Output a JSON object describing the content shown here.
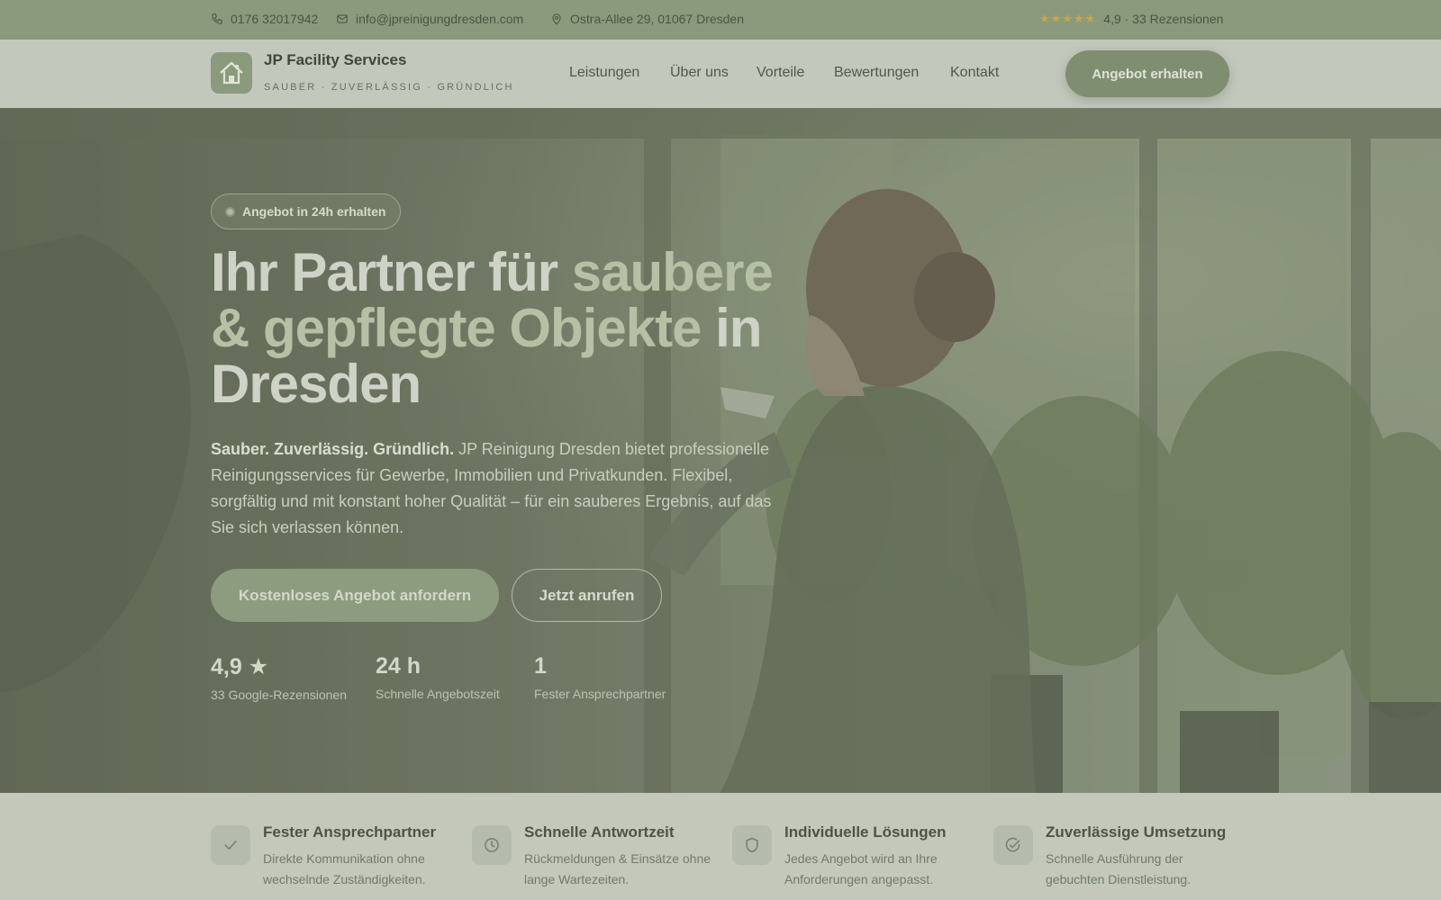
{
  "topbar": {
    "phone": "0176 32017942",
    "email": "info@jpreinigungdresden.com",
    "address": "Ostra-Allee 29, 01067 Dresden",
    "stars": "★★★★★",
    "rating_text": "4,9 · 33 Rezensionen"
  },
  "nav": {
    "brand": "JP Facility Services",
    "tagline": "SAUBER · ZUVERLÄSSIG · GRÜNDLICH",
    "links": [
      "Leistungen",
      "Über uns",
      "Vorteile",
      "Bewertungen",
      "Kontakt"
    ],
    "cta": "Angebot erhalten"
  },
  "hero": {
    "pill": "Angebot in 24h erhalten",
    "headline_1": "Ihr Partner für ",
    "headline_accent": "saubere & gepflegte Objekte",
    "headline_2": " in Dresden",
    "lead_bold": "Sauber. Zuverlässig. Gründlich.",
    "lead_text": " JP Reinigung Dresden bietet professionelle Reinigungsservices für Gewerbe, Immobilien und Privatkunden. Flexibel, sorgfältig und mit konstant hoher Qualität – für ein sauberes Ergebnis, auf das Sie sich verlassen können.",
    "btn_primary": "Kostenloses Angebot anfordern",
    "btn_secondary": "Jetzt anrufen",
    "stats": [
      {
        "num": "4,9 ★",
        "label": "33 Google-Rezensionen"
      },
      {
        "num": "24 h",
        "label": "Schnelle Angebotszeit"
      },
      {
        "num": "1",
        "label": "Fester Ansprechpartner"
      }
    ]
  },
  "features": [
    {
      "title": "Fester Ansprechpartner",
      "desc": "Direkte Kommunikation ohne wechselnde Zuständigkeiten.",
      "icon": "check-icon"
    },
    {
      "title": "Schnelle Antwortzeit",
      "desc": "Rückmeldungen & Einsätze ohne lange Wartezeiten.",
      "icon": "clock-icon"
    },
    {
      "title": "Individuelle Lösungen",
      "desc": "Jedes Angebot wird an Ihre Anforderungen angepasst.",
      "icon": "shield-icon"
    },
    {
      "title": "Zuverlässige Umsetzung",
      "desc": "Schnelle Ausführung der gebuchten Dienstleistung.",
      "icon": "check-circle-icon"
    }
  ],
  "colors": {
    "accent": "#8b9a7c",
    "star": "#c8a64b"
  }
}
